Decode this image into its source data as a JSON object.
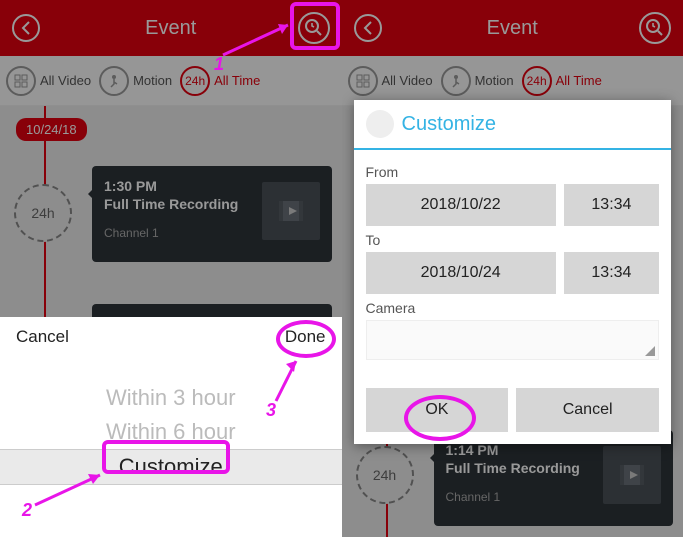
{
  "left": {
    "header": {
      "title": "Event"
    },
    "tabs": {
      "allVideo": "All Video",
      "motion": "Motion",
      "allTime": "All Time",
      "allTimeIcon": "24h"
    },
    "date_badge": "10/24/18",
    "marker_icon": "24h",
    "card": {
      "time": "1:30 PM",
      "subtitle": "Full Time Recording",
      "channel": "Channel 1"
    },
    "picker": {
      "cancel": "Cancel",
      "done": "Done",
      "rows": [
        "Within 3 hour",
        "Within 6 hour",
        "Customize"
      ]
    },
    "annotations": {
      "n1": "1",
      "n2": "2",
      "n3": "3"
    }
  },
  "right": {
    "header": {
      "title": "Event"
    },
    "tabs": {
      "allVideo": "All Video",
      "motion": "Motion",
      "allTime": "All Time",
      "allTimeIcon": "24h"
    },
    "dialog": {
      "title": "Customize",
      "from_label": "From",
      "to_label": "To",
      "camera_label": "Camera",
      "from_date": "2018/10/22",
      "from_time": "13:34",
      "to_date": "2018/10/24",
      "to_time": "13:34",
      "ok": "OK",
      "cancel": "Cancel"
    },
    "card": {
      "time": "1:14 PM",
      "subtitle": "Full Time Recording",
      "channel": "Channel 1"
    },
    "marker_icon": "24h"
  }
}
